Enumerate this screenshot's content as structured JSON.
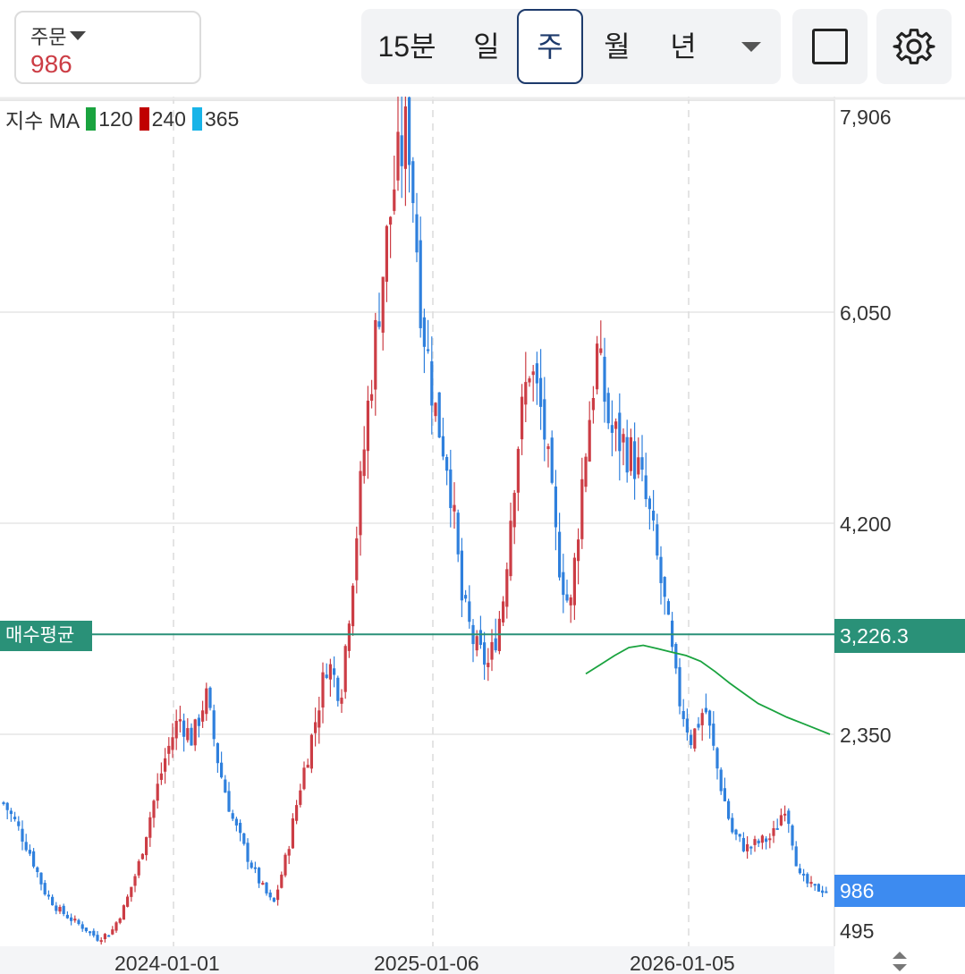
{
  "order": {
    "label": "주문",
    "value": "986"
  },
  "periods": [
    "15분",
    "일",
    "주",
    "월",
    "년"
  ],
  "active_period": "주",
  "legend": {
    "prefix": "지수 MA",
    "ma1": "120",
    "ma2": "240",
    "ma3": "365"
  },
  "colors": {
    "up": "#cc3d45",
    "down": "#2f80dd",
    "ma120": "#1aa33f",
    "ma240": "#c00000",
    "ma365": "#18b4e8",
    "avg_line": "#2a9178",
    "last_price": "#3d8bf0"
  },
  "avg_tag": "매수평균",
  "avg_price_label": "3,226.3",
  "last_price_label": "986",
  "chart_data": {
    "type": "candlestick",
    "y_ticks": [
      "7,906",
      "6,050",
      "4,200",
      "2,350",
      "495"
    ],
    "x_ticks": [
      "2024-01-01",
      "2025-01-06",
      "2026-01-05"
    ],
    "avg_buy_price": 3226.3,
    "last_price": 986,
    "ylim": [
      495,
      7906
    ],
    "overall_close_path": [
      1750,
      1550,
      1300,
      980,
      820,
      730,
      650,
      560,
      620,
      850,
      1200,
      1700,
      2150,
      2500,
      2300,
      2700,
      2050,
      1600,
      1300,
      1050,
      850,
      1300,
      1900,
      2400,
      3000,
      2700,
      3900,
      5200,
      6300,
      7200,
      7700,
      6050,
      5200,
      4700,
      3500,
      3100,
      2950,
      3500,
      4800,
      5600,
      5100,
      4000,
      3400,
      4700,
      5700,
      5000,
      4900,
      4700,
      4200,
      3500,
      2700,
      2300,
      2600,
      2000,
      1500,
      1350,
      1400,
      1450,
      1750,
      1100,
      1000,
      986
    ],
    "ma_series": {
      "name": "120",
      "points": [
        2880,
        2960,
        3040,
        3110,
        3130,
        3100,
        3070,
        3040,
        2990,
        2900,
        2800,
        2710,
        2620,
        2560,
        2500,
        2450,
        2400,
        2350
      ]
    }
  }
}
